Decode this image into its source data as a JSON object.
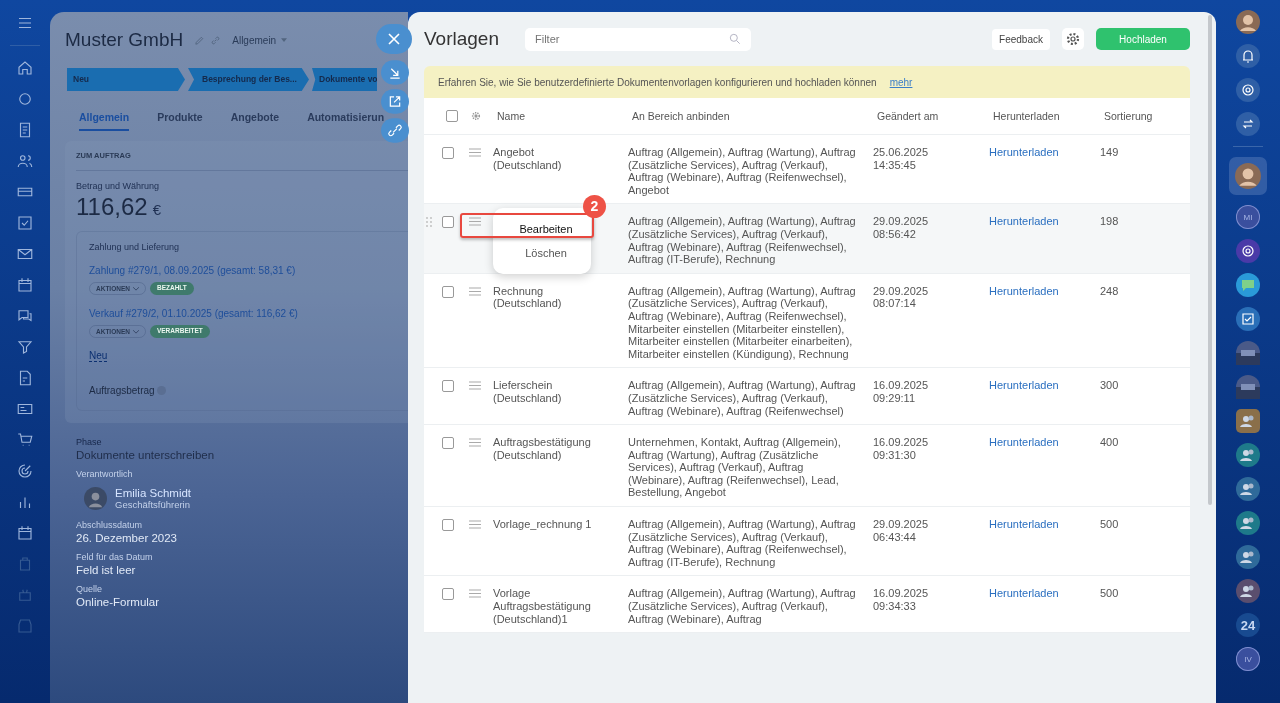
{
  "crm_card": {
    "title": "Muster GmbH",
    "category": "Allgemein",
    "stages": [
      "Neu",
      "Besprechung der Bes...",
      "Dokumente vo"
    ],
    "tabs": [
      {
        "label": "Allgemein",
        "selected": true
      },
      {
        "label": "Produkte",
        "selected": false
      },
      {
        "label": "Angebote",
        "selected": false
      },
      {
        "label": "Automatisierun",
        "selected": false
      }
    ],
    "section_title": "ZUM AUFTRAG",
    "amount_label": "Betrag und Währung",
    "amount": "116,62",
    "currency": "€",
    "payment_box": {
      "title": "Zahlung und Lieferung",
      "entries": [
        {
          "link": "Zahlung #279/1, 08.09.2025 (gesamt: 58,31 €)",
          "action": "AKTIONEN",
          "status": "BEZAHLT"
        },
        {
          "link": "Verkauf #279/2, 01.10.2025 (gesamt: 116,62 €)",
          "action": "AKTIONEN",
          "status": "VERARBEITET"
        }
      ],
      "new_link": "Neu",
      "total_label": "Auftragsbetrag"
    },
    "fields": [
      {
        "label": "Phase",
        "value": "Dokumente unterschreiben"
      },
      {
        "label": "Verantwortlich",
        "person": "Emilia Schmidt",
        "role": "Geschäftsführerin"
      },
      {
        "label": "Abschlussdatum",
        "value": "26. Dezember 2023"
      },
      {
        "label": "Feld für das Datum",
        "value": "Feld ist leer"
      },
      {
        "label": "Quelle",
        "value": "Online-Formular"
      }
    ]
  },
  "modal": {
    "title": "Vorlagen",
    "filter": {
      "placeholder": "Filter"
    },
    "feedback_button": "Feedback",
    "upload_button": "Hochladen",
    "notice": {
      "text": "Erfahren Sie, wie Sie benutzerdefinierte Dokumentenvorlagen konfigurieren und hochladen können",
      "link": "mehr"
    },
    "table": {
      "all_checked": false,
      "columns": [
        "Name",
        "An Bereich anbinden",
        "Geändert am",
        "Herunterladen",
        "Sortierung"
      ],
      "rows": [
        {
          "checked": false,
          "hovered": false,
          "name": "Angebot (Deutschland)",
          "bindings": "Auftrag (Allgemein), Auftrag (Wartung), Auftrag (Zusätzliche Services), Auftrag (Verkauf), Auftrag (Webinare), Auftrag (Reifenwechsel), Angebot",
          "date": "25.06.2025",
          "time": "14:35:45",
          "download": "Herunterladen",
          "sort": "149"
        },
        {
          "checked": false,
          "hovered": true,
          "bindings": "Auftrag (Allgemein), Auftrag (Wartung), Auftrag (Zusätzliche Services), Auftrag (Verkauf), Auftrag (Webinare), Auftrag (Reifenwechsel), Auftrag (IT-Berufe), Rechnung",
          "date": "29.09.2025",
          "time": "08:56:42",
          "download": "Herunterladen",
          "sort": "198",
          "menu": {
            "step": "2",
            "items": [
              {
                "label": "Bearbeiten",
                "highlighted": true
              },
              {
                "label": "Löschen",
                "highlighted": false
              }
            ]
          }
        },
        {
          "checked": false,
          "hovered": false,
          "name": "Rechnung (Deutschland)",
          "bindings": "Auftrag (Allgemein), Auftrag (Wartung), Auftrag (Zusätzliche Services), Auftrag (Verkauf), Auftrag (Webinare), Auftrag (Reifenwechsel), Mitarbeiter einstellen (Mitarbeiter einstellen), Mitarbeiter einstellen (Mitarbeiter einarbeiten), Mitarbeiter einstellen (Kündigung), Rechnung",
          "date": "29.09.2025",
          "time": "08:07:14",
          "download": "Herunterladen",
          "sort": "248"
        },
        {
          "checked": false,
          "hovered": false,
          "name": "Lieferschein (Deutschland)",
          "bindings": "Auftrag (Allgemein), Auftrag (Wartung), Auftrag (Zusätzliche Services), Auftrag (Verkauf), Auftrag (Webinare), Auftrag (Reifenwechsel)",
          "date": "16.09.2025",
          "time": "09:29:11",
          "download": "Herunterladen",
          "sort": "300"
        },
        {
          "checked": false,
          "hovered": false,
          "name": "Auftragsbestätigung (Deutschland)",
          "bindings": "Unternehmen, Kontakt, Auftrag (Allgemein), Auftrag (Wartung), Auftrag (Zusätzliche Services), Auftrag (Verkauf), Auftrag (Webinare), Auftrag (Reifenwechsel), Lead, Bestellung, Angebot",
          "date": "16.09.2025",
          "time": "09:31:30",
          "download": "Herunterladen",
          "sort": "400"
        },
        {
          "checked": false,
          "hovered": false,
          "name": "Vorlage_rechnung 1",
          "bindings": "Auftrag (Allgemein), Auftrag (Wartung), Auftrag (Zusätzliche Services), Auftrag (Verkauf), Auftrag (Webinare), Auftrag (Reifenwechsel), Auftrag (IT-Berufe), Rechnung",
          "date": "29.09.2025",
          "time": "06:43:44",
          "download": "Herunterladen",
          "sort": "500"
        },
        {
          "checked": false,
          "hovered": false,
          "name": "Vorlage Auftragsbestätigung (Deutschland)1",
          "bindings": "Auftrag (Allgemein), Auftrag (Wartung), Auftrag (Zusätzliche Services), Auftrag (Verkauf), Auftrag (Webinare), Auftrag",
          "date": "16.09.2025",
          "time": "09:34:33",
          "download": "Herunterladen",
          "sort": "500"
        }
      ]
    }
  },
  "right_bar": {
    "labels": [
      "MI",
      "24",
      "IV"
    ]
  }
}
